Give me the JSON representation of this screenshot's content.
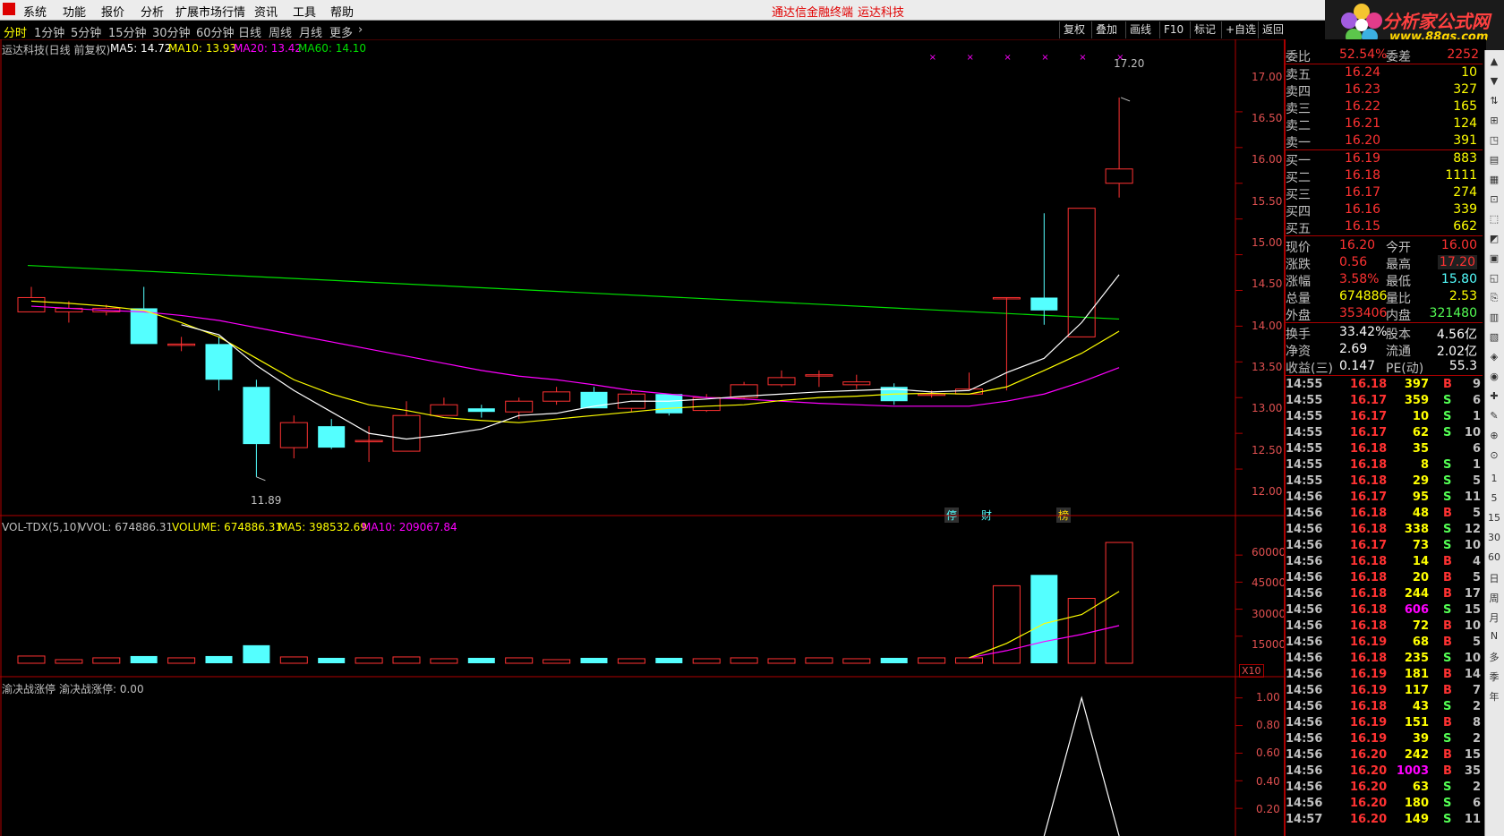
{
  "menu": [
    "系统",
    "功能",
    "报价",
    "分析",
    "扩展市场行情",
    "资讯",
    "工具",
    "帮助"
  ],
  "brand_left": "通达信金融终端",
  "brand_right": "运达科技",
  "logo": {
    "text": "分析家公式网",
    "url_text": "www.88gs.com"
  },
  "periods": [
    "分时",
    "1分钟",
    "5分钟",
    "15分钟",
    "30分钟",
    "60分钟",
    "日线",
    "周线",
    "月线",
    "更多"
  ],
  "toolbar": [
    "复权",
    "叠加",
    "画线",
    "F10",
    "标记",
    "+自选",
    "返回"
  ],
  "main_info": {
    "name": "运达科技(日线 前复权)",
    "ma5": "MA5: 14.72",
    "ma10": "MA10: 13.93",
    "ma20": "MA20: 13.42",
    "ma60": "MA60: 14.10"
  },
  "price_labels": [
    "17.00",
    "16.50",
    "16.00",
    "15.50",
    "15.00",
    "14.50",
    "14.00",
    "13.50",
    "13.00",
    "12.50",
    "12.00"
  ],
  "high_label": "17.20",
  "low_label": "11.89",
  "event_markers": [
    "停",
    "财",
    "榜"
  ],
  "vol_info": {
    "name": "VOL-TDX(5,10)",
    "vvol": "VVOL: 674886.31",
    "volume": "VOLUME: 674886.31",
    "ma5": "MA5: 398532.69",
    "ma10": "MA10: 209067.84"
  },
  "vol_labels": [
    "60000",
    "45000",
    "30000",
    "15000"
  ],
  "vol_unit": "X10",
  "ind_info": {
    "name": "渝决战涨停",
    "value": "渝决战涨停: 0.00"
  },
  "ind_labels": [
    "1.00",
    "0.80",
    "0.60",
    "0.40",
    "0.20"
  ],
  "chart_data": {
    "type": "candlestick",
    "title": "运达科技(日线 前复权)",
    "ylim": [
      11.7,
      17.5
    ],
    "candles": [
      {
        "o": 14.2,
        "c": 14.4,
        "h": 14.55,
        "l": 14.2
      },
      {
        "o": 14.2,
        "c": 14.25,
        "h": 14.35,
        "l": 14.05
      },
      {
        "o": 14.2,
        "c": 14.25,
        "h": 14.3,
        "l": 14.15
      },
      {
        "o": 14.25,
        "c": 13.75,
        "h": 14.55,
        "l": 13.75
      },
      {
        "o": 13.75,
        "c": 13.75,
        "h": 13.85,
        "l": 13.65
      },
      {
        "o": 13.75,
        "c": 13.25,
        "h": 13.85,
        "l": 13.1
      },
      {
        "o": 13.15,
        "c": 12.35,
        "h": 13.25,
        "l": 11.89
      },
      {
        "o": 12.3,
        "c": 12.65,
        "h": 12.75,
        "l": 12.15
      },
      {
        "o": 12.6,
        "c": 12.3,
        "h": 12.7,
        "l": 12.28
      },
      {
        "o": 12.4,
        "c": 12.4,
        "h": 12.6,
        "l": 12.1
      },
      {
        "o": 12.25,
        "c": 12.75,
        "h": 12.95,
        "l": 12.25
      },
      {
        "o": 12.75,
        "c": 12.9,
        "h": 13.0,
        "l": 12.75
      },
      {
        "o": 12.85,
        "c": 12.8,
        "h": 12.9,
        "l": 12.72
      },
      {
        "o": 12.8,
        "c": 12.95,
        "h": 13.0,
        "l": 12.7
      },
      {
        "o": 12.95,
        "c": 13.08,
        "h": 13.15,
        "l": 12.9
      },
      {
        "o": 13.08,
        "c": 12.85,
        "h": 13.15,
        "l": 12.85
      },
      {
        "o": 12.85,
        "c": 13.05,
        "h": 13.1,
        "l": 12.8
      },
      {
        "o": 13.05,
        "c": 12.78,
        "h": 13.05,
        "l": 12.75
      },
      {
        "o": 12.82,
        "c": 13.0,
        "h": 13.05,
        "l": 12.8
      },
      {
        "o": 13.0,
        "c": 13.18,
        "h": 13.22,
        "l": 12.98
      },
      {
        "o": 13.18,
        "c": 13.28,
        "h": 13.38,
        "l": 13.15
      },
      {
        "o": 13.32,
        "c": 13.32,
        "h": 13.38,
        "l": 13.15
      },
      {
        "o": 13.18,
        "c": 13.22,
        "h": 13.32,
        "l": 13.12
      },
      {
        "o": 13.15,
        "c": 12.95,
        "h": 13.2,
        "l": 12.9
      },
      {
        "o": 13.05,
        "c": 13.05,
        "h": 13.1,
        "l": 13.0
      },
      {
        "o": 13.05,
        "c": 13.12,
        "h": 13.35,
        "l": 13.05
      },
      {
        "o": 14.4,
        "c": 14.4,
        "h": 14.4,
        "l": 13.1
      },
      {
        "o": 14.4,
        "c": 14.22,
        "h": 15.58,
        "l": 14.02
      },
      {
        "o": 13.85,
        "c": 15.65,
        "h": 15.65,
        "l": 13.85
      },
      {
        "o": 16.0,
        "c": 16.2,
        "h": 17.2,
        "l": 15.8
      }
    ],
    "ma5": [
      null,
      null,
      null,
      null,
      14.02,
      13.88,
      13.45,
      13.1,
      12.8,
      12.5,
      12.42,
      12.48,
      12.56,
      12.75,
      12.78,
      12.88,
      12.95,
      12.95,
      12.98,
      13.02,
      13.05,
      13.08,
      13.1,
      13.12,
      13.08,
      13.1,
      13.35,
      13.55,
      14.05,
      14.72
    ],
    "ma10": [
      14.35,
      14.32,
      14.28,
      14.22,
      14.05,
      13.85,
      13.55,
      13.25,
      13.05,
      12.9,
      12.82,
      12.72,
      12.68,
      12.65,
      12.7,
      12.75,
      12.8,
      12.85,
      12.88,
      12.9,
      12.96,
      13.0,
      13.02,
      13.05,
      13.06,
      13.05,
      13.15,
      13.38,
      13.62,
      13.93
    ],
    "ma20": [
      14.28,
      14.25,
      14.22,
      14.2,
      14.15,
      14.08,
      13.98,
      13.88,
      13.78,
      13.68,
      13.58,
      13.48,
      13.38,
      13.3,
      13.25,
      13.18,
      13.1,
      13.05,
      13.0,
      12.98,
      12.95,
      12.92,
      12.9,
      12.88,
      12.88,
      12.88,
      12.95,
      13.05,
      13.22,
      13.42
    ],
    "ma60_segment": {
      "start": [
        0,
        14.85
      ],
      "end": [
        29,
        14.1
      ]
    },
    "volume": [
      4000,
      2000,
      3000,
      4000,
      3000,
      4000,
      10000,
      3500,
      3000,
      3000,
      3500,
      2500,
      3000,
      3000,
      2000,
      3000,
      2500,
      3000,
      2500,
      3000,
      2500,
      3000,
      2500,
      3000,
      3000,
      3000,
      43000,
      49000,
      36000,
      67000
    ],
    "vol_ylim": [
      0,
      70000
    ],
    "vol_ma5": [
      null,
      null,
      null,
      null,
      null,
      null,
      null,
      null,
      null,
      null,
      null,
      null,
      null,
      null,
      null,
      null,
      null,
      null,
      null,
      null,
      null,
      null,
      null,
      null,
      null,
      3000,
      11000,
      22000,
      27000,
      39853
    ],
    "vol_ma10": [
      null,
      null,
      null,
      null,
      null,
      null,
      null,
      null,
      null,
      null,
      null,
      null,
      null,
      null,
      null,
      null,
      null,
      null,
      null,
      null,
      null,
      null,
      null,
      null,
      null,
      3000,
      7000,
      12000,
      16000,
      20906
    ],
    "indicator": {
      "ylim": [
        0,
        1.05
      ],
      "x": [
        27,
        28,
        29
      ],
      "y": [
        0,
        1,
        0
      ]
    }
  },
  "quote": {
    "weibi": {
      "label": "委比",
      "value": "52.54%",
      "label2": "委差",
      "value2": "2252"
    },
    "asks": [
      {
        "label": "卖五",
        "price": "16.24",
        "vol": "10"
      },
      {
        "label": "卖四",
        "price": "16.23",
        "vol": "327"
      },
      {
        "label": "卖三",
        "price": "16.22",
        "vol": "165"
      },
      {
        "label": "卖二",
        "price": "16.21",
        "vol": "124"
      },
      {
        "label": "卖一",
        "price": "16.20",
        "vol": "391"
      }
    ],
    "bids": [
      {
        "label": "买一",
        "price": "16.19",
        "vol": "883"
      },
      {
        "label": "买二",
        "price": "16.18",
        "vol": "1111"
      },
      {
        "label": "买三",
        "price": "16.17",
        "vol": "274"
      },
      {
        "label": "买四",
        "price": "16.16",
        "vol": "339"
      },
      {
        "label": "买五",
        "price": "16.15",
        "vol": "662"
      }
    ],
    "stats": [
      {
        "l1": "现价",
        "v1": "16.20",
        "l2": "今开",
        "v2": "16.00"
      },
      {
        "l1": "涨跌",
        "v1": "0.56",
        "l2": "最高",
        "v2": "17.20"
      },
      {
        "l1": "涨幅",
        "v1": "3.58%",
        "l2": "最低",
        "v2": "15.80"
      },
      {
        "l1": "总量",
        "v1": "674886",
        "l2": "量比",
        "v2": "2.53"
      },
      {
        "l1": "外盘",
        "v1": "353406",
        "l2": "内盘",
        "v2": "321480"
      }
    ],
    "fund": [
      {
        "l1": "换手",
        "v1": "33.42%",
        "l2": "股本",
        "v2": "4.56亿"
      },
      {
        "l1": "净资",
        "v1": "2.69",
        "l2": "流通",
        "v2": "2.02亿"
      },
      {
        "l1": "收益(三)",
        "v1": "0.147",
        "l2": "PE(动)",
        "v2": "55.3"
      }
    ]
  },
  "ticks": [
    {
      "t": "14:55",
      "p": "16.18",
      "v": "397",
      "d": "B",
      "n": "9"
    },
    {
      "t": "14:55",
      "p": "16.17",
      "v": "359",
      "d": "S",
      "n": "6"
    },
    {
      "t": "14:55",
      "p": "16.17",
      "v": "10",
      "d": "S",
      "n": "1"
    },
    {
      "t": "14:55",
      "p": "16.17",
      "v": "62",
      "d": "S",
      "n": "10"
    },
    {
      "t": "14:55",
      "p": "16.18",
      "v": "35",
      "d": "",
      "n": "6"
    },
    {
      "t": "14:55",
      "p": "16.18",
      "v": "8",
      "d": "S",
      "n": "1"
    },
    {
      "t": "14:55",
      "p": "16.18",
      "v": "29",
      "d": "S",
      "n": "5"
    },
    {
      "t": "14:56",
      "p": "16.17",
      "v": "95",
      "d": "S",
      "n": "11"
    },
    {
      "t": "14:56",
      "p": "16.18",
      "v": "48",
      "d": "B",
      "n": "5"
    },
    {
      "t": "14:56",
      "p": "16.18",
      "v": "338",
      "d": "S",
      "n": "12"
    },
    {
      "t": "14:56",
      "p": "16.17",
      "v": "73",
      "d": "S",
      "n": "10"
    },
    {
      "t": "14:56",
      "p": "16.18",
      "v": "14",
      "d": "B",
      "n": "4"
    },
    {
      "t": "14:56",
      "p": "16.18",
      "v": "20",
      "d": "B",
      "n": "5"
    },
    {
      "t": "14:56",
      "p": "16.18",
      "v": "244",
      "d": "B",
      "n": "17"
    },
    {
      "t": "14:56",
      "p": "16.18",
      "v": "606",
      "d": "S",
      "n": "15"
    },
    {
      "t": "14:56",
      "p": "16.18",
      "v": "72",
      "d": "B",
      "n": "10"
    },
    {
      "t": "14:56",
      "p": "16.19",
      "v": "68",
      "d": "B",
      "n": "5"
    },
    {
      "t": "14:56",
      "p": "16.18",
      "v": "235",
      "d": "S",
      "n": "10"
    },
    {
      "t": "14:56",
      "p": "16.19",
      "v": "181",
      "d": "B",
      "n": "14"
    },
    {
      "t": "14:56",
      "p": "16.19",
      "v": "117",
      "d": "B",
      "n": "7"
    },
    {
      "t": "14:56",
      "p": "16.18",
      "v": "43",
      "d": "S",
      "n": "2"
    },
    {
      "t": "14:56",
      "p": "16.19",
      "v": "151",
      "d": "B",
      "n": "8"
    },
    {
      "t": "14:56",
      "p": "16.19",
      "v": "39",
      "d": "S",
      "n": "2"
    },
    {
      "t": "14:56",
      "p": "16.20",
      "v": "242",
      "d": "B",
      "n": "15"
    },
    {
      "t": "14:56",
      "p": "16.20",
      "v": "1003",
      "d": "B",
      "n": "35"
    },
    {
      "t": "14:56",
      "p": "16.20",
      "v": "63",
      "d": "S",
      "n": "2"
    },
    {
      "t": "14:56",
      "p": "16.20",
      "v": "180",
      "d": "S",
      "n": "6"
    },
    {
      "t": "14:57",
      "p": "16.20",
      "v": "149",
      "d": "S",
      "n": "11"
    }
  ],
  "sidebar_labels": [
    "1",
    "5",
    "15",
    "30",
    "60",
    "日",
    "周",
    "月",
    "N",
    "多",
    "季",
    "年"
  ],
  "colors": {
    "up": "#ff3232",
    "down": "#54ffff",
    "ma5": "#ffffff",
    "ma10": "#ffff00",
    "ma20": "#ff00ff",
    "ma60": "#00e000",
    "axis": "#b00000"
  }
}
